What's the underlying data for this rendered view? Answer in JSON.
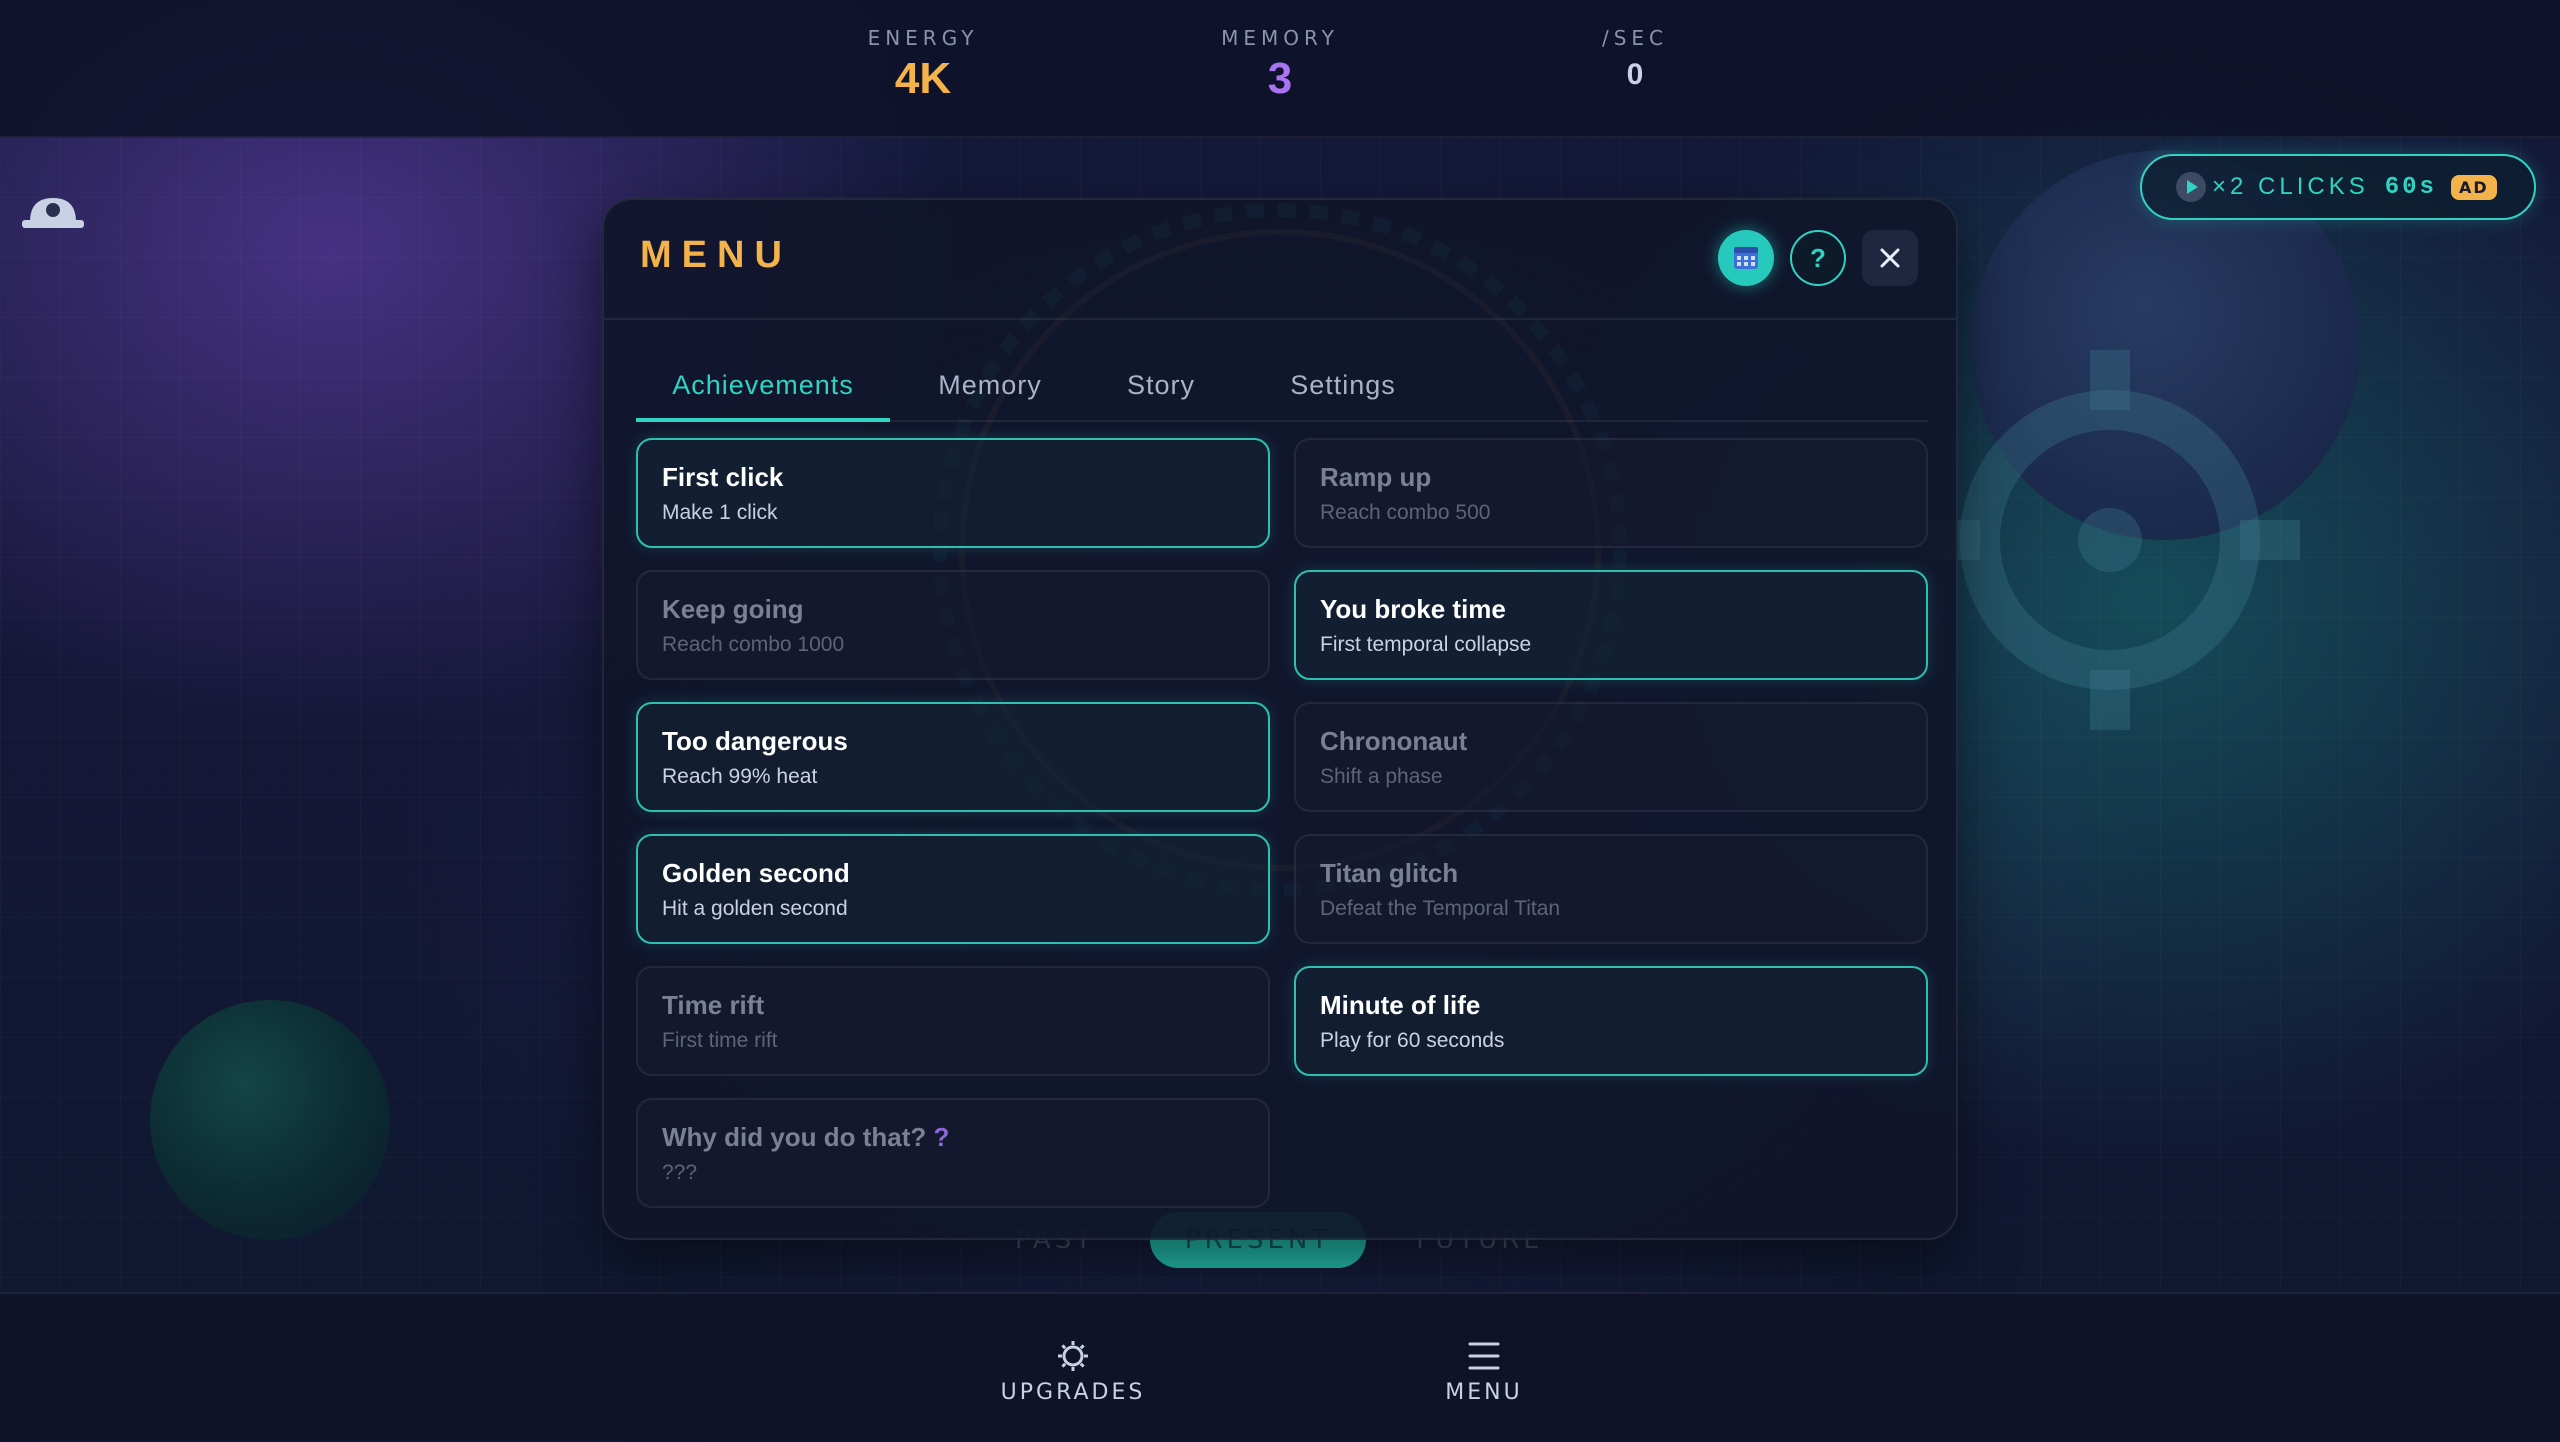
{
  "stats": {
    "energy": {
      "label": "ENERGY",
      "value": "4K"
    },
    "memory": {
      "label": "MEMORY",
      "value": "3"
    },
    "per_sec": {
      "label": "/SEC",
      "value": "0"
    }
  },
  "boost": {
    "label": "×2 CLICKS",
    "seconds": "60s",
    "badge": "AD"
  },
  "modal": {
    "title": "MENU",
    "tabs": [
      {
        "label": "Achievements",
        "active": true
      },
      {
        "label": "Memory",
        "active": false
      },
      {
        "label": "Story",
        "active": false
      },
      {
        "label": "Settings",
        "active": false
      }
    ],
    "achievements": [
      {
        "title": "First click",
        "desc": "Make 1 click",
        "unlocked": true
      },
      {
        "title": "Ramp up",
        "desc": "Reach combo 500",
        "unlocked": false
      },
      {
        "title": "Keep going",
        "desc": "Reach combo 1000",
        "unlocked": false
      },
      {
        "title": "You broke time",
        "desc": "First temporal collapse",
        "unlocked": true
      },
      {
        "title": "Too dangerous",
        "desc": "Reach 99% heat",
        "unlocked": true
      },
      {
        "title": "Chrononaut",
        "desc": "Shift a phase",
        "unlocked": false
      },
      {
        "title": "Golden second",
        "desc": "Hit a golden second",
        "unlocked": true
      },
      {
        "title": "Titan glitch",
        "desc": "Defeat the Temporal Titan",
        "unlocked": false
      },
      {
        "title": "Time rift",
        "desc": "First time rift",
        "unlocked": false
      },
      {
        "title": "Minute of life",
        "desc": "Play for 60 seconds",
        "unlocked": true
      },
      {
        "title": "Why did you do that?",
        "title_suffix": "?",
        "desc": "???",
        "unlocked": false
      }
    ]
  },
  "background_phases": [
    "PAST",
    "PRESENT",
    "FUTURE"
  ],
  "nav": {
    "upgrades": "UPGRADES",
    "menu": "MENU"
  },
  "colors": {
    "accent_teal": "#2fd3c1",
    "energy_gold": "#f4b24a",
    "memory_purple": "#a974f2"
  },
  "icons": {
    "calendar": "calendar-icon",
    "help": "help-icon",
    "close": "close-icon",
    "upgrades": "gear-icon",
    "menu": "hamburger-icon",
    "boost_play": "play-icon",
    "corner": "helmet-icon"
  }
}
